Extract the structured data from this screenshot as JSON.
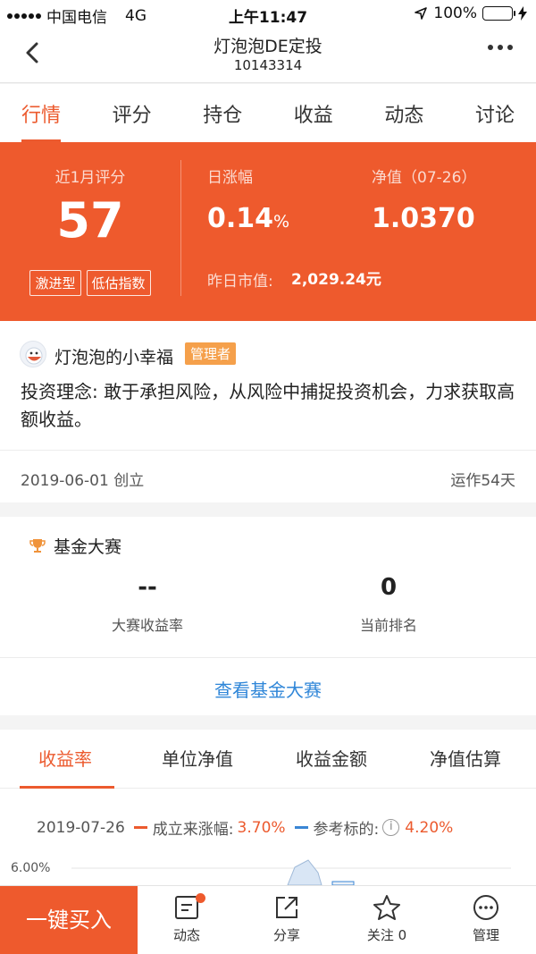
{
  "status_bar": {
    "carrier": "中国电信",
    "network": "4G",
    "time": "上午11:47",
    "battery": "100%",
    "battery_level": 1.0
  },
  "navbar": {
    "title": "灯泡泡DE定投",
    "subtitle": "10143314"
  },
  "top_tabs": [
    {
      "label": "行情",
      "active": true
    },
    {
      "label": "评分",
      "active": false
    },
    {
      "label": "持仓",
      "active": false
    },
    {
      "label": "收益",
      "active": false
    },
    {
      "label": "动态",
      "active": false
    },
    {
      "label": "讨论",
      "active": false
    }
  ],
  "summary": {
    "score_label": "近1月评分",
    "score": "57",
    "tags": [
      "激进型",
      "低估指数"
    ],
    "daily_change_label": "日涨幅",
    "daily_change_value": "0.14",
    "daily_change_unit": "%",
    "nav_label": "净值（07-26）",
    "nav_value": "1.0370",
    "market_value_label": "昨日市值:",
    "market_value": "2,029.24元"
  },
  "manager": {
    "name": "灯泡泡的小幸福",
    "role_badge": "管理者",
    "philosophy": "投资理念: 敢于承担风险，从风险中捕捉投资机会，力求获取高额收益。"
  },
  "info": {
    "created": "2019-06-01 创立",
    "running": "运作54天"
  },
  "contest": {
    "title": "基金大赛",
    "return_value": "--",
    "return_label": "大赛收益率",
    "rank_value": "0",
    "rank_label": "当前排名",
    "link": "查看基金大赛"
  },
  "chart_tabs": [
    {
      "label": "收益率",
      "active": true
    },
    {
      "label": "单位净值",
      "active": false
    },
    {
      "label": "收益金额",
      "active": false
    },
    {
      "label": "净值估算",
      "active": false
    }
  ],
  "chart": {
    "date": "2019-07-26",
    "series1_label": "成立来涨幅:",
    "series1_value": "3.70%",
    "series1_color": "#ec5a2e",
    "series2_label": "参考标的:",
    "series2_value": "4.20%",
    "series2_color": "#3a86d4",
    "ytick_top": "6.00%"
  },
  "bottom_bar": {
    "buy_label": "一键买入",
    "items": [
      {
        "label": "动态",
        "icon": "feed-icon",
        "has_dot": true
      },
      {
        "label": "分享",
        "icon": "share-icon",
        "has_dot": false
      },
      {
        "label": "关注 0",
        "icon": "star-icon",
        "has_dot": false
      },
      {
        "label": "管理",
        "icon": "more-circle-icon",
        "has_dot": false
      }
    ]
  },
  "colors": {
    "accent": "#ee5a2d",
    "link": "#2f86d8",
    "badge": "#f5a04b"
  }
}
